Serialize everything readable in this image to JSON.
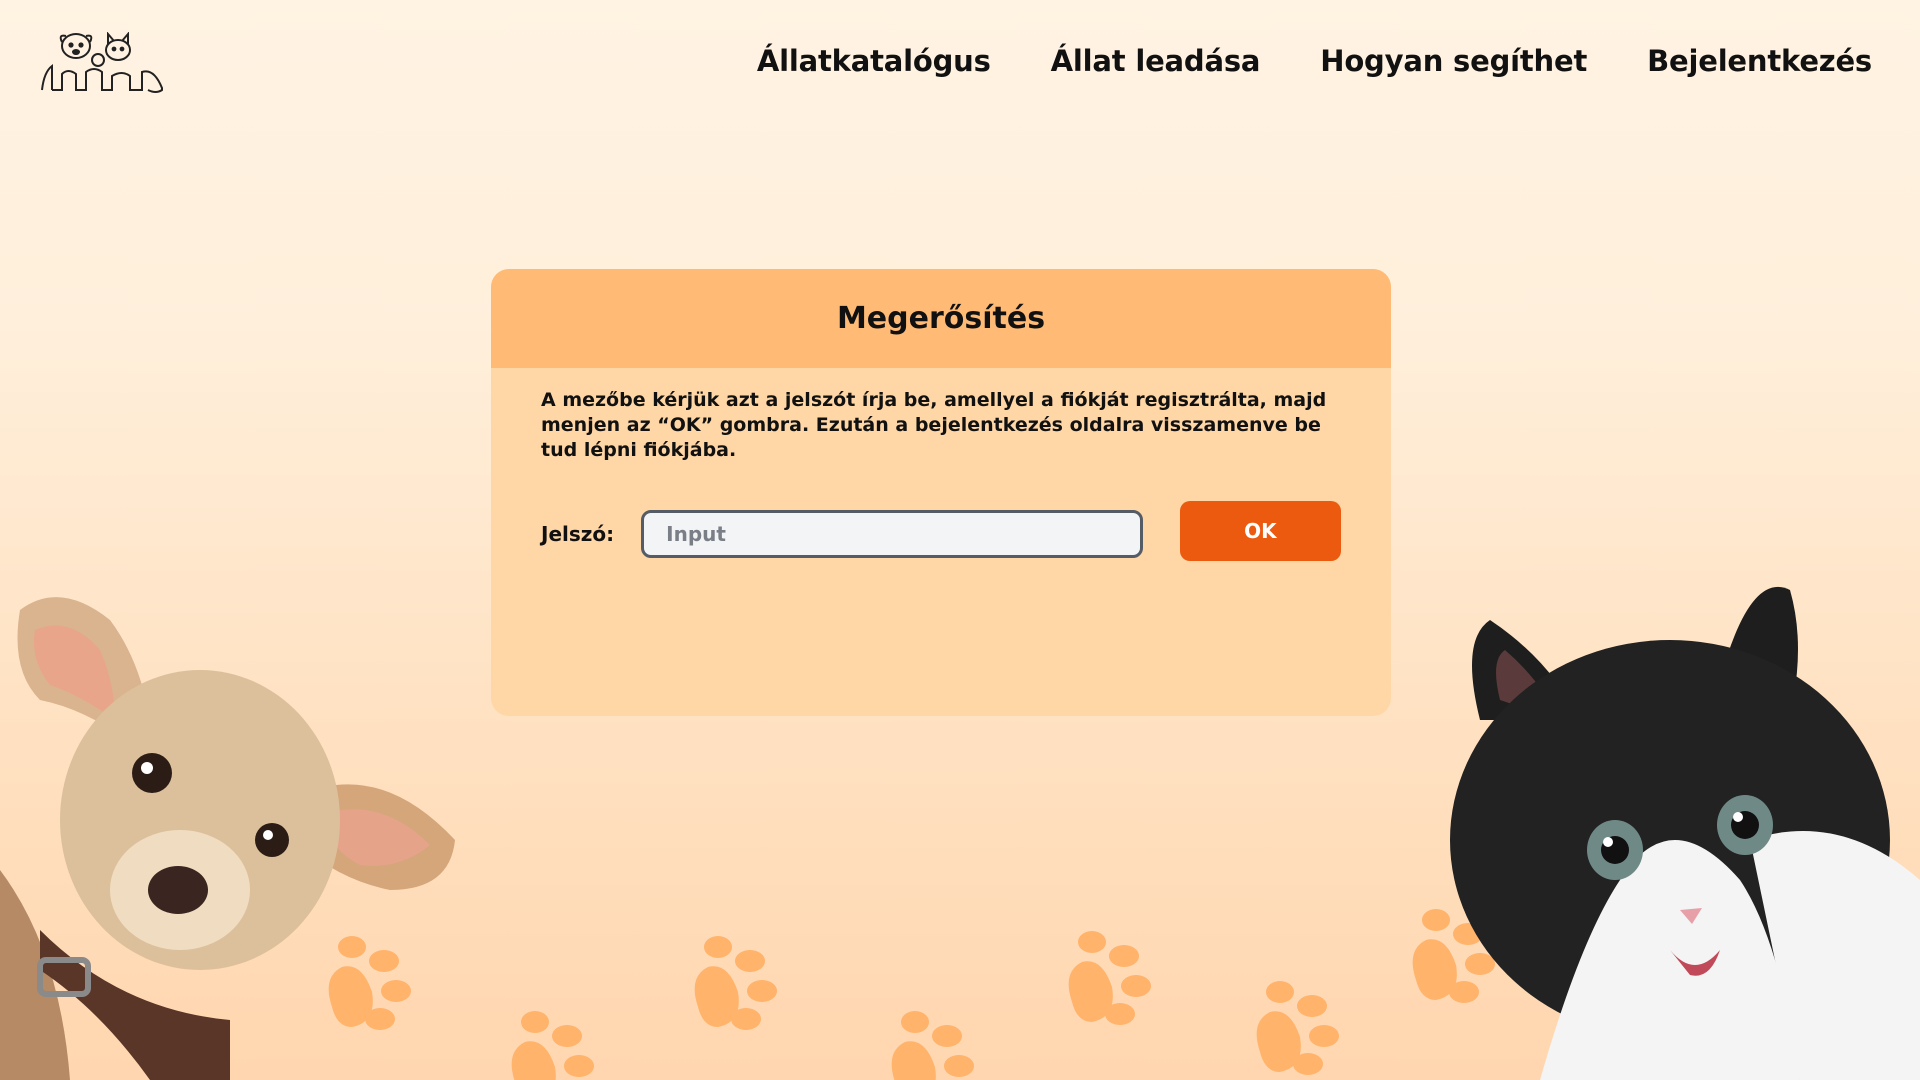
{
  "brand": {
    "logo_icon": "dog-and-cat-logo-icon"
  },
  "nav": {
    "items": [
      "Állatkatalógus",
      "Állat leadása",
      "Hogyan segíthet",
      "Bejelentkezés"
    ]
  },
  "dialog": {
    "title": "Megerősítés",
    "instructions": "A mezőbe kérjük azt a jelszót írja be, amellyel a fiókját regisztrálta, majd menjen az “OK” gombra. Ezután a bejelentkezés oldalra visszamenve be tud lépni fiókjába.",
    "password_label": "Jelszó:",
    "password_placeholder": "Input",
    "password_value": "",
    "ok_label": "OK"
  },
  "colors": {
    "header_band": "#ffbb76",
    "card": "#ffd6a6",
    "button": "#eb5a0f",
    "paw": "#ffb36b"
  }
}
